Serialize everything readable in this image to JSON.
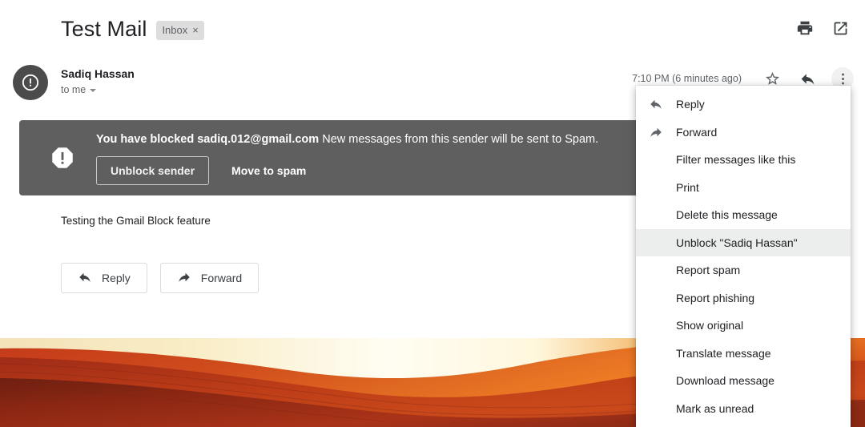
{
  "header": {
    "subject": "Test Mail",
    "label_chip": "Inbox",
    "label_chip_remove": "×",
    "print_icon": "printer-icon",
    "popout_icon": "open-in-new-window-icon"
  },
  "message": {
    "sender_name": "Sadiq Hassan",
    "recipient": "to me",
    "timestamp": "7:10 PM (6 minutes ago)",
    "avatar_icon": "warning-exclamation-icon",
    "star_icon": "star-outline-icon",
    "reply_icon": "reply-arrow-icon",
    "more_icon": "more-vertical-icon",
    "body": "Testing the Gmail Block feature"
  },
  "banner": {
    "icon": "octagon-exclamation-icon",
    "bold_text": "You have blocked sadiq.012@gmail.com",
    "rest_text": " New messages from this sender will be sent to Spam.",
    "unblock_label": "Unblock sender",
    "spam_label": "Move to spam",
    "background": "#5f5f5f"
  },
  "reply_bar": {
    "reply_label": "Reply",
    "forward_label": "Forward",
    "reply_icon": "reply-arrow-icon",
    "forward_icon": "forward-arrow-icon"
  },
  "menu": {
    "highlight_color": "#eceded",
    "items": [
      {
        "label": "Reply",
        "icon": "reply-arrow-icon",
        "active": false
      },
      {
        "label": "Forward",
        "icon": "forward-arrow-icon",
        "active": false
      },
      {
        "label": "Filter messages like this",
        "icon": "",
        "active": false
      },
      {
        "label": "Print",
        "icon": "",
        "active": false
      },
      {
        "label": "Delete this message",
        "icon": "",
        "active": false
      },
      {
        "label": "Unblock \"Sadiq Hassan\"",
        "icon": "",
        "active": true
      },
      {
        "label": "Report spam",
        "icon": "",
        "active": false
      },
      {
        "label": "Report phishing",
        "icon": "",
        "active": false
      },
      {
        "label": "Show original",
        "icon": "",
        "active": false
      },
      {
        "label": "Translate message",
        "icon": "",
        "active": false
      },
      {
        "label": "Download message",
        "icon": "",
        "active": false
      },
      {
        "label": "Mark as unread",
        "icon": "",
        "active": false
      }
    ]
  },
  "attachment_image": {
    "alt": "antelope-canyon-photo"
  }
}
